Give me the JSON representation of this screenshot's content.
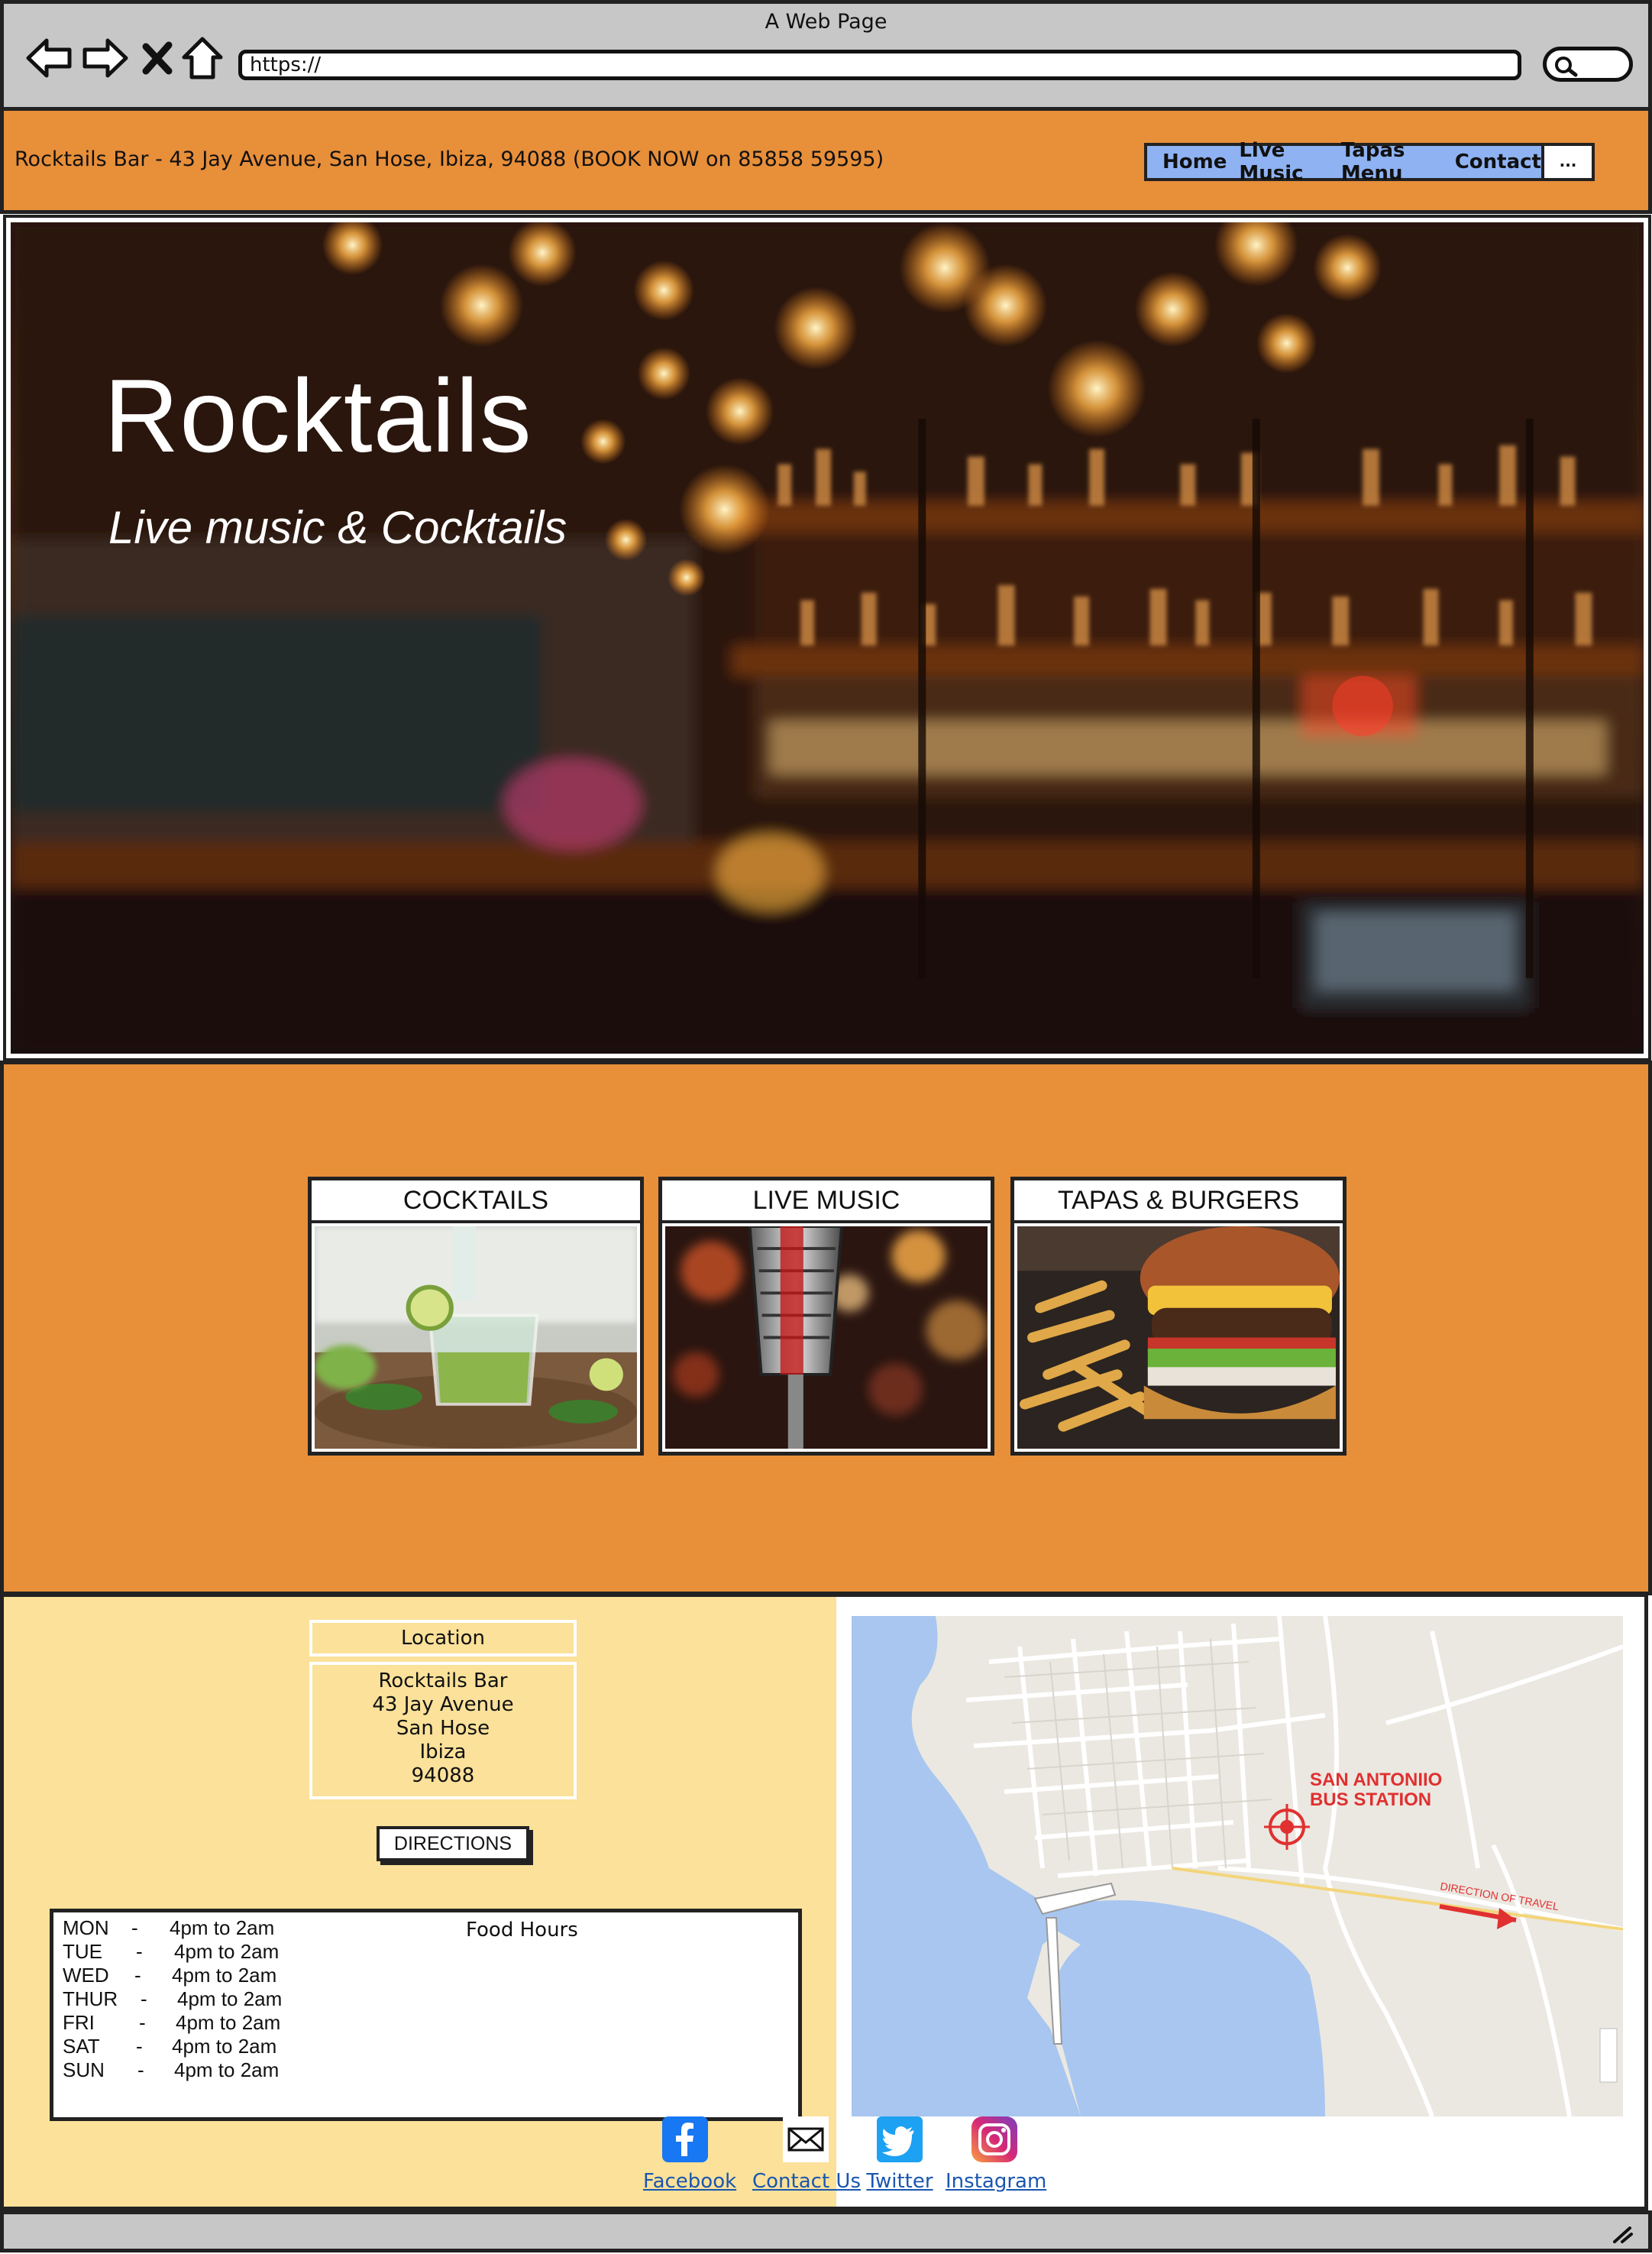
{
  "browser": {
    "window_title": "A Web Page",
    "url": "https://"
  },
  "topbar": {
    "address": "Rocktails Bar - 43 Jay Avenue, San Hose, Ibiza, 94088 (BOOK NOW on 85858 59595)",
    "nav": [
      "Home",
      "Live Music",
      "Tapas Menu",
      "Contact"
    ],
    "more": "..."
  },
  "hero": {
    "title": "Rocktails",
    "subtitle": "Live music & Cocktails"
  },
  "features": [
    {
      "label": "COCKTAILS"
    },
    {
      "label": "LIVE MUSIC"
    },
    {
      "label": "TAPAS & BURGERS"
    }
  ],
  "location": {
    "title": "Location",
    "lines": [
      "Rocktails Bar",
      "43 Jay Avenue",
      "San Hose",
      "Ibiza",
      "94088"
    ]
  },
  "directions_label": "DIRECTIONS",
  "hours": {
    "title": "Food Hours",
    "rows": [
      {
        "day": "MON",
        "dash": "-",
        "time": "4pm to 2am"
      },
      {
        "day": "TUE",
        "dash": "-",
        "time": "4pm to 2am"
      },
      {
        "day": "WED",
        "dash": "-",
        "time": "4pm to 2am"
      },
      {
        "day": "THUR",
        "dash": "-",
        "time": "4pm to 2am"
      },
      {
        "day": "FRI",
        "dash": "-",
        "time": "4pm to 2am"
      },
      {
        "day": "SAT",
        "dash": "-",
        "time": "4pm to 2am"
      },
      {
        "day": "SUN",
        "dash": "-",
        "time": "4pm to 2am"
      }
    ]
  },
  "map": {
    "label_line1": "SAN ANTONIIO",
    "label_line2": "BUS STATION",
    "direction_label": "DIRECTION OF TRAVEL"
  },
  "social": [
    {
      "label": "Facebook",
      "icon": "facebook-icon"
    },
    {
      "label": "Contact Us",
      "icon": "mail-icon"
    },
    {
      "label": "Twitter",
      "icon": "twitter-icon"
    },
    {
      "label": "Instagram",
      "icon": "instagram-icon"
    }
  ],
  "colors": {
    "accent_orange": "#e88f3a",
    "nav_blue": "#8eb2f2",
    "info_yellow": "#fbe199",
    "link_blue": "#1a56b0",
    "chrome_gray": "#c7c7c7"
  }
}
